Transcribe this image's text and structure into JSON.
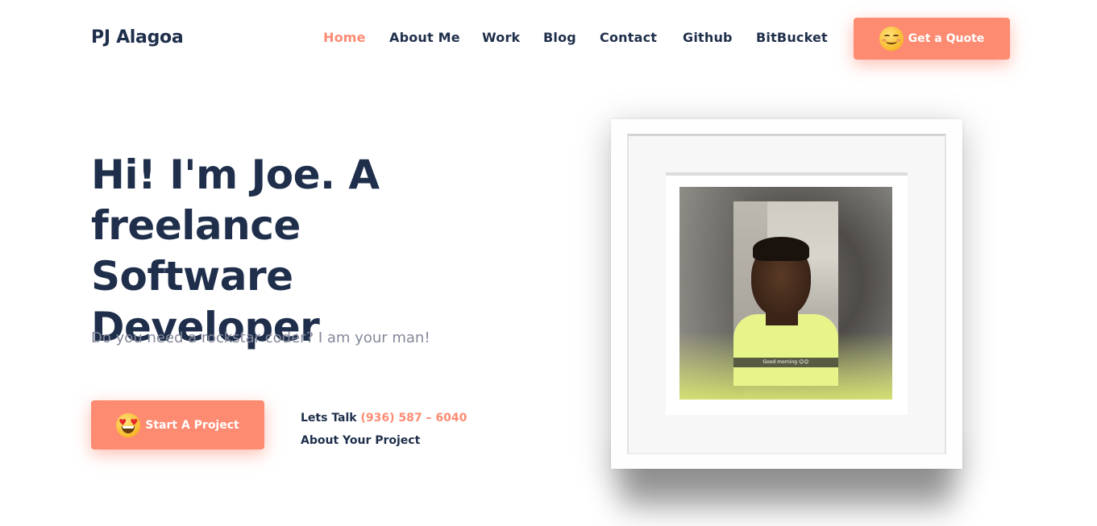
{
  "header": {
    "logo": "PJ Alagoa",
    "nav": [
      {
        "label": "Home",
        "active": true
      },
      {
        "label": "About Me",
        "active": false
      },
      {
        "label": "Work",
        "active": false
      },
      {
        "label": "Blog",
        "active": false
      },
      {
        "label": "Contact",
        "active": false
      },
      {
        "label": "Github",
        "active": false
      },
      {
        "label": "BitBucket",
        "active": false
      }
    ],
    "quote_button": {
      "label": "Get a Quote",
      "icon": "smiling-face-icon"
    }
  },
  "hero": {
    "headline_line1": "Hi! I'm Joe. A",
    "headline_line2": "freelance Software",
    "headline_line3": "Developer",
    "subtitle": "Do you need a rockstar coder? I am your man!",
    "start_button": {
      "label": "Start A Project",
      "icon": "heart-eyes-face-icon"
    },
    "talk_prefix": "Lets Talk",
    "phone": "(936) 587 – 6040",
    "talk_suffix": "About Your Project"
  },
  "portrait": {
    "caption": "Good morning 😊😊"
  },
  "colors": {
    "accent": "#fd8b72",
    "text_dark": "#1f2f4b",
    "text_muted": "#84889a"
  }
}
